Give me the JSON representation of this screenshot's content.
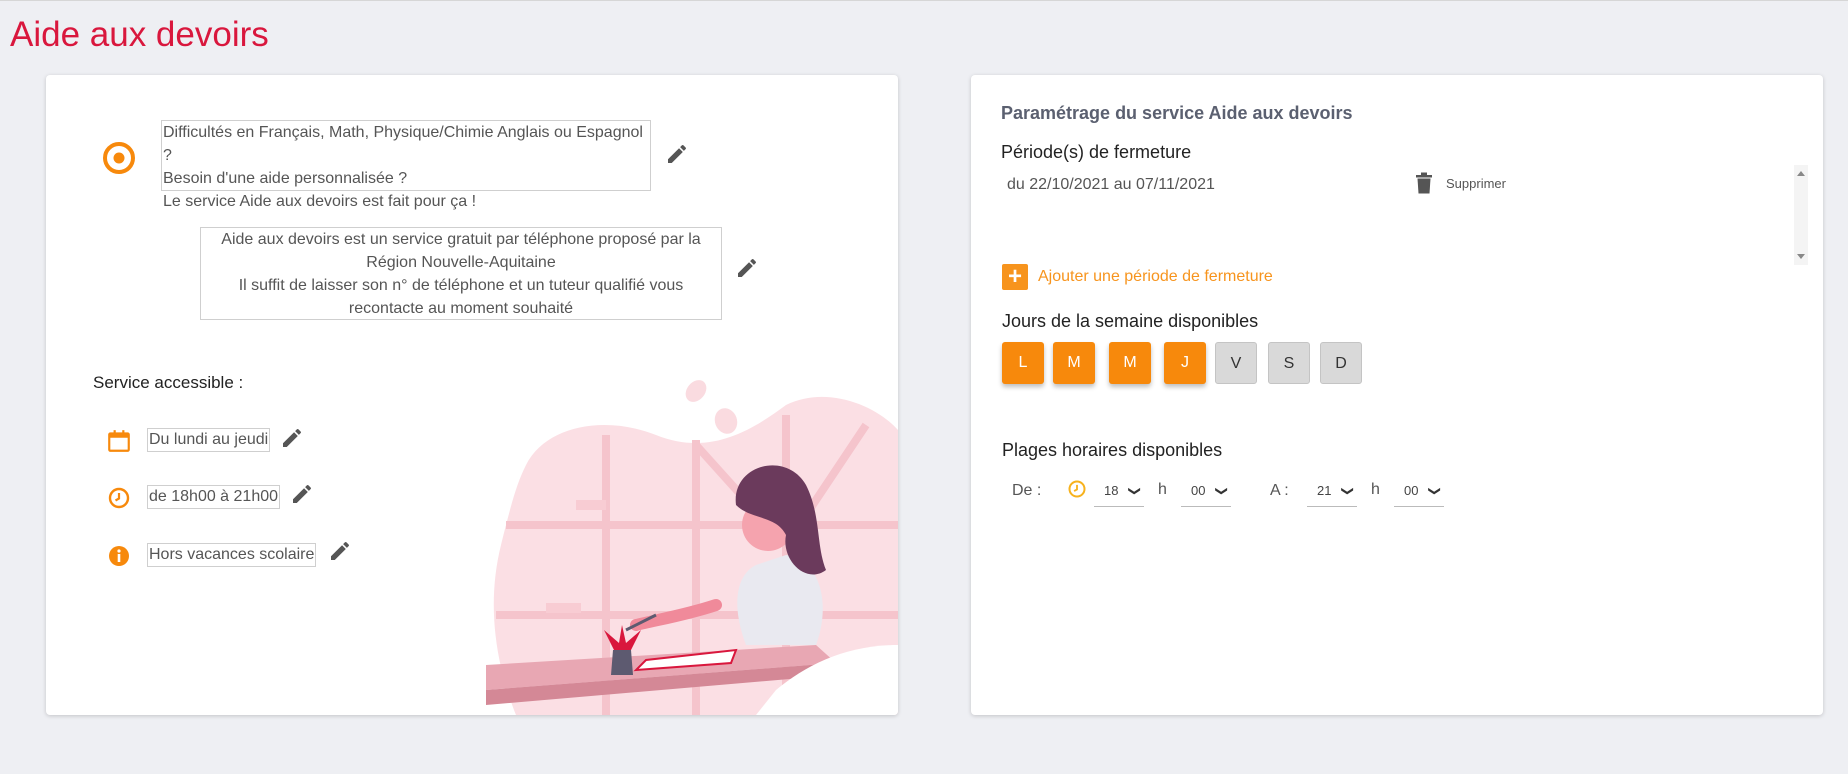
{
  "page": {
    "title": "Aide aux devoirs"
  },
  "left": {
    "intro_lines": [
      "Difficultés en Français, Math, Physique/Chimie Anglais ou Espagnol ?",
      "Besoin d'une aide personnalisée ?",
      "Le service Aide aux devoirs est fait pour ça !"
    ],
    "description_lines": [
      "Aide aux devoirs est un service gratuit par téléphone proposé par la",
      "Région Nouvelle-Aquitaine",
      "Il suffit de laisser son n° de téléphone et un tuteur qualifié vous",
      "recontacte au moment souhaité"
    ],
    "service_heading": "Service accessible :",
    "days_text": "Du lundi au jeudi",
    "hours_text": "de 18h00 à 21h00",
    "vacation_text": "Hors vacances scolaire"
  },
  "right": {
    "heading": "Paramétrage du service Aide aux devoirs",
    "closing_label": "Période(s) de fermeture",
    "periods": [
      {
        "text": "du 22/10/2021 au 07/11/2021",
        "delete_label": "Supprimer"
      }
    ],
    "add_period_label": "Ajouter une période de fermeture",
    "days_label": "Jours de la semaine disponibles",
    "days": [
      {
        "label": "L",
        "selected": true
      },
      {
        "label": "M",
        "selected": true
      },
      {
        "label": "M",
        "selected": true
      },
      {
        "label": "J",
        "selected": true
      },
      {
        "label": "V",
        "selected": false
      },
      {
        "label": "S",
        "selected": false
      },
      {
        "label": "D",
        "selected": false
      }
    ],
    "hours_label": "Plages horaires disponibles",
    "from_label": "De :",
    "to_label": "A :",
    "h_label": "h",
    "from_hour": "18",
    "from_min": "00",
    "to_hour": "21",
    "to_min": "00"
  },
  "colors": {
    "accent": "#f7890c",
    "title": "#d9173d",
    "day_off": "#d9d9d9",
    "background": "#eeeff3"
  },
  "icons": [
    "target-icon",
    "pencil-icon",
    "calendar-icon",
    "clock-icon",
    "info-icon",
    "trash-icon",
    "plus-icon",
    "chevron-down-icon"
  ]
}
